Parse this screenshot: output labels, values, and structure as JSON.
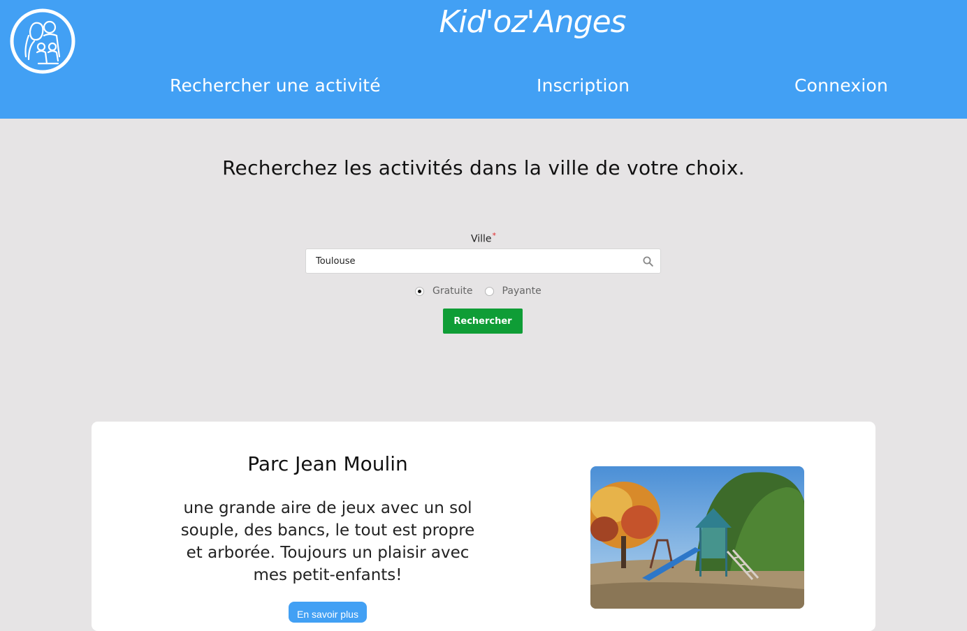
{
  "header": {
    "brand": "Kid'oz'Anges",
    "nav": {
      "search": "Rechercher une activité",
      "signup": "Inscription",
      "login": "Connexion"
    }
  },
  "search": {
    "title": "Recherchez les activités dans la ville de votre choix.",
    "city_label": "Ville",
    "required_mark": "*",
    "city_value": "Toulouse",
    "radio_free": "Gratuite",
    "radio_paid": "Payante",
    "selected_option": "Gratuite",
    "submit": "Rechercher"
  },
  "card": {
    "title": "Parc Jean Moulin",
    "description": "une grande aire de jeux avec un sol souple, des bancs, le tout est propre et arborée. Toujours un plaisir avec mes petit-enfants!",
    "more_button": "En savoir plus"
  },
  "colors": {
    "header_bg": "#42a0f4",
    "page_bg": "#e6e4e5",
    "submit_bg": "#0f9d36",
    "more_bg": "#42a0f4"
  }
}
